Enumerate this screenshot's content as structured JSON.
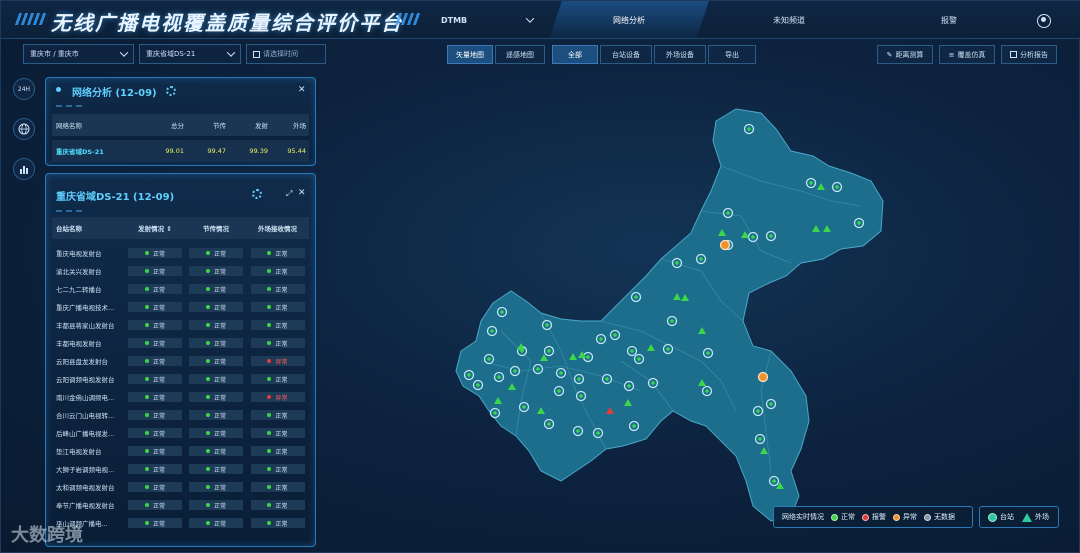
{
  "header": {
    "title": "无线广播电视覆盖质量综合评价平台",
    "standard": "DTMB",
    "tabs": [
      "网络分析",
      "未知频道",
      "报警"
    ],
    "active_tab": 0
  },
  "toolbar": {
    "region_select": "重庆市 / 重庆市",
    "network_select": "重庆省域DS-21",
    "time_placeholder": "请选择时间",
    "map_modes": [
      "矢量地图",
      "遥感地图"
    ],
    "filters": [
      "全部",
      "台站设备",
      "外场设备"
    ],
    "export_label": "导出",
    "right_actions": [
      "距离测算",
      "覆盖仿真",
      "分析报告"
    ]
  },
  "rail": {
    "btn_24h": "24H"
  },
  "analysis_panel": {
    "title": "网络分析 (12-09)",
    "columns": [
      "网络名称",
      "总分",
      "节传",
      "发射",
      "外场"
    ],
    "row": [
      "重庆省域DS-21",
      "99.01",
      "99.47",
      "99.39",
      "95.44"
    ]
  },
  "station_panel": {
    "title": "重庆省域DS-21 (12-09)",
    "columns": [
      "台站名称",
      "发射情况 ⇕",
      "节传情况",
      "外场接收情况"
    ],
    "rows": [
      [
        "重庆电视发射台",
        "正常",
        "正常",
        "正常"
      ],
      [
        "渝北关兴发射台",
        "正常",
        "正常",
        "正常"
      ],
      [
        "七二九二转播台",
        "正常",
        "正常",
        "正常"
      ],
      [
        "重庆广播电视技术...",
        "正常",
        "正常",
        "正常"
      ],
      [
        "丰都县蒋家山发射台",
        "正常",
        "正常",
        "正常"
      ],
      [
        "丰都电视发射台",
        "正常",
        "正常",
        "正常"
      ],
      [
        "云阳县盘龙发射台",
        "正常",
        "正常",
        "异常"
      ],
      [
        "云阳调频电视发射台",
        "正常",
        "正常",
        "正常"
      ],
      [
        "南川金佛山调频电...",
        "正常",
        "正常",
        "异常"
      ],
      [
        "合川云门山电视转...",
        "正常",
        "正常",
        "正常"
      ],
      [
        "后峰山广播电视发...",
        "正常",
        "正常",
        "正常"
      ],
      [
        "垫江电视发射台",
        "正常",
        "正常",
        "正常"
      ],
      [
        "大狮子岩调频电视...",
        "正常",
        "正常",
        "正常"
      ],
      [
        "太和调频电视发射台",
        "正常",
        "正常",
        "正常"
      ],
      [
        "奉节广播电视发射台",
        "正常",
        "正常",
        "正常"
      ],
      [
        "巫山调频广播电...",
        "正常",
        "正常",
        "正常"
      ]
    ]
  },
  "legend": {
    "label": "网络实时情况",
    "items": [
      "正常",
      "报警",
      "异常",
      "无数据"
    ],
    "type_items": [
      "台站",
      "外场"
    ]
  },
  "watermark": "大数跨境",
  "colors": {
    "normal": "#3bd64a",
    "alarm": "#e23b3b",
    "abnormal": "#f0922b",
    "nodata": "#8a96a3",
    "accent": "#5fd0ff",
    "region_fill": "#1d6d8c"
  }
}
